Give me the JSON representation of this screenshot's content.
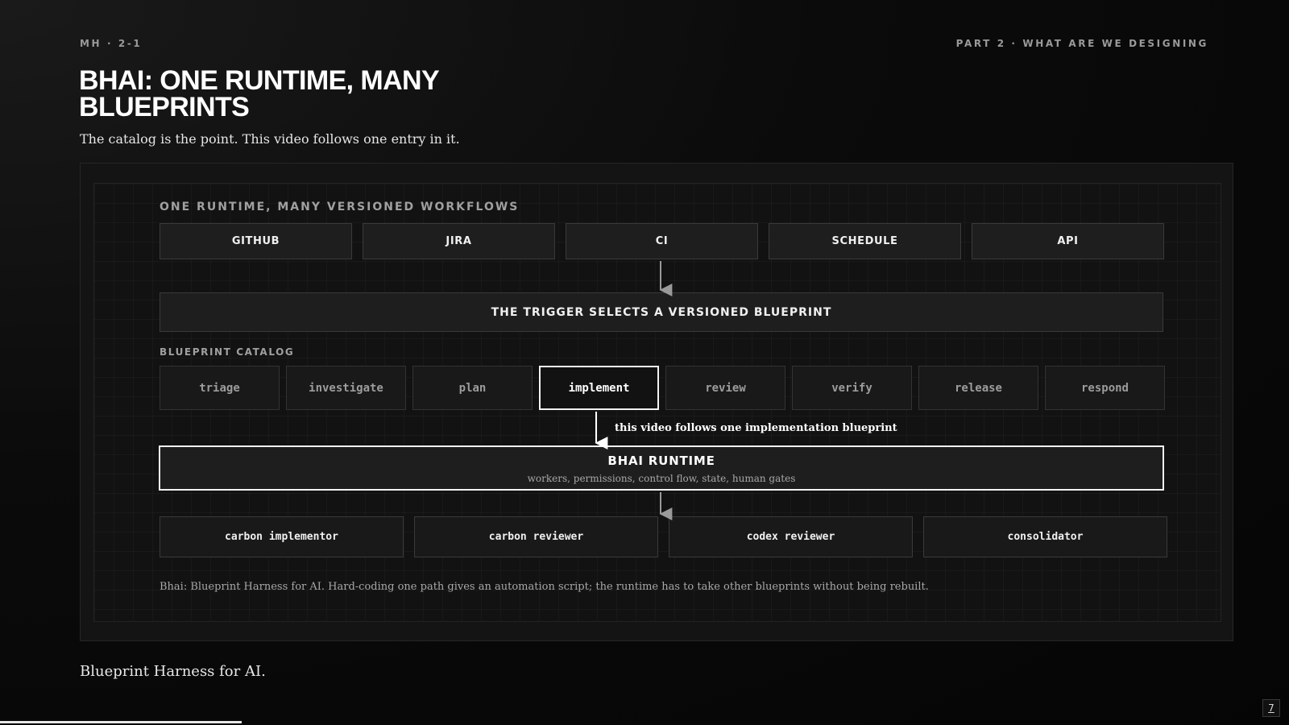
{
  "header": {
    "slide_id": "MH · 2-1",
    "section": "PART 2 · WHAT ARE WE DESIGNING"
  },
  "title": "BHAI: ONE RUNTIME, MANY BLUEPRINTS",
  "subtitle": "The catalog is the point. This video follows one entry in it.",
  "diagram": {
    "triggers_label": "ONE RUNTIME, MANY VERSIONED WORKFLOWS",
    "triggers": [
      "GITHUB",
      "JIRA",
      "CI",
      "SCHEDULE",
      "API"
    ],
    "selector": "THE TRIGGER SELECTS A VERSIONED BLUEPRINT",
    "catalog_label": "BLUEPRINT CATALOG",
    "blueprints": [
      "triage",
      "investigate",
      "plan",
      "implement",
      "review",
      "verify",
      "release",
      "respond"
    ],
    "selected_blueprint": "implement",
    "follow_note": "this video follows one implementation blueprint",
    "runtime": {
      "title": "BHAI RUNTIME",
      "subtitle": "workers, permissions, control flow, state, human gates"
    },
    "workers": [
      "carbon implementor",
      "carbon reviewer",
      "codex reviewer",
      "consolidator"
    ],
    "footnote": "Bhai: Blueprint Harness for AI. Hard-coding one path gives an automation script; the runtime has to take other blueprints without being rebuilt."
  },
  "caption": "Blueprint Harness for AI.",
  "page_number": "7"
}
